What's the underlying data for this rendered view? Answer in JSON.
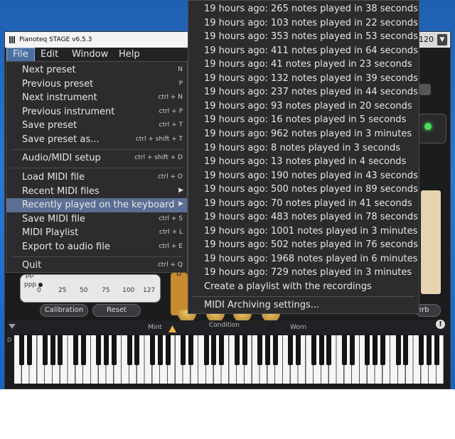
{
  "window": {
    "title": "Pianoteq STAGE v6.5.3",
    "close_glyph": "×"
  },
  "menubar": {
    "items": [
      "File",
      "Edit",
      "Window",
      "Help"
    ]
  },
  "preset_value": "120",
  "preset_arrow_glyph": "▼",
  "file_menu": {
    "items": [
      {
        "label": "Next preset",
        "shortcut": "N"
      },
      {
        "label": "Previous preset",
        "shortcut": "P"
      },
      {
        "label": "Next instrument",
        "shortcut": "ctrl + N"
      },
      {
        "label": "Previous instrument",
        "shortcut": "ctrl + P"
      },
      {
        "label": "Save preset",
        "shortcut": "ctrl + T"
      },
      {
        "label": "Save preset as...",
        "shortcut": "ctrl + shift + T"
      },
      {
        "label": "Audio/MIDI setup",
        "shortcut": "ctrl + shift + D"
      },
      {
        "label": "Load MIDI file",
        "shortcut": "ctrl + O"
      },
      {
        "label": "Recent MIDI files",
        "shortcut": ""
      },
      {
        "label": "Recently played on the keyboard",
        "shortcut": ""
      },
      {
        "label": "Save MIDI file",
        "shortcut": "ctrl + S"
      },
      {
        "label": "MIDI Playlist",
        "shortcut": "ctrl + L"
      },
      {
        "label": "Export to audio file",
        "shortcut": "ctrl + E"
      },
      {
        "label": "Quit",
        "shortcut": "ctrl + Q"
      }
    ],
    "submenu_arrow_glyph": "▶"
  },
  "recent_menu": {
    "recordings": [
      "19 hours ago: 265 notes played in 38 seconds",
      "19 hours ago: 103 notes played in 22 seconds",
      "19 hours ago: 353 notes played in 53 seconds",
      "19 hours ago: 411 notes played in 64 seconds",
      "19 hours ago: 41 notes played in 23 seconds",
      "19 hours ago: 132 notes played in 39 seconds",
      "19 hours ago: 237 notes played in 44 seconds",
      "19 hours ago: 93 notes played in 20 seconds",
      "19 hours ago: 16 notes played in 5 seconds",
      "19 hours ago: 962 notes played in 3 minutes",
      "19 hours ago: 8 notes played in 3 seconds",
      "19 hours ago: 13 notes played in 4 seconds",
      "19 hours ago: 190 notes played in 43 seconds",
      "19 hours ago: 500 notes played in 89 seconds",
      "19 hours ago: 70 notes played in 41 seconds",
      "19 hours ago: 483 notes played in 78 seconds",
      "19 hours ago: 1001 notes played in 3 minutes",
      "19 hours ago: 502 notes played in 76 seconds",
      "19 hours ago: 1968 notes played in 6 minutes",
      "19 hours ago: 729 notes played in 3 minutes"
    ],
    "create_playlist": "Create a playlist with the recordings",
    "archiving_settings": "MIDI Archiving settings..."
  },
  "velocity": {
    "labels": [
      "pp",
      "ppp"
    ],
    "ticks": [
      "0",
      "25",
      "50",
      "75",
      "100",
      "127"
    ]
  },
  "buttons": {
    "calibration": "Calibration",
    "reset": "Reset",
    "reverb_partial": "erb",
    "pedal_partial": "D"
  },
  "condition": {
    "label": "Condition",
    "left": "Mint",
    "right": "Worn"
  },
  "warning_glyph": "!",
  "keyboard_left_glyph": "D",
  "colors": {
    "menu_bg": "#2c2c2e",
    "highlight": "#5a6f93",
    "desktop": "#2a78d0",
    "app_bg": "#1b1c1e"
  }
}
